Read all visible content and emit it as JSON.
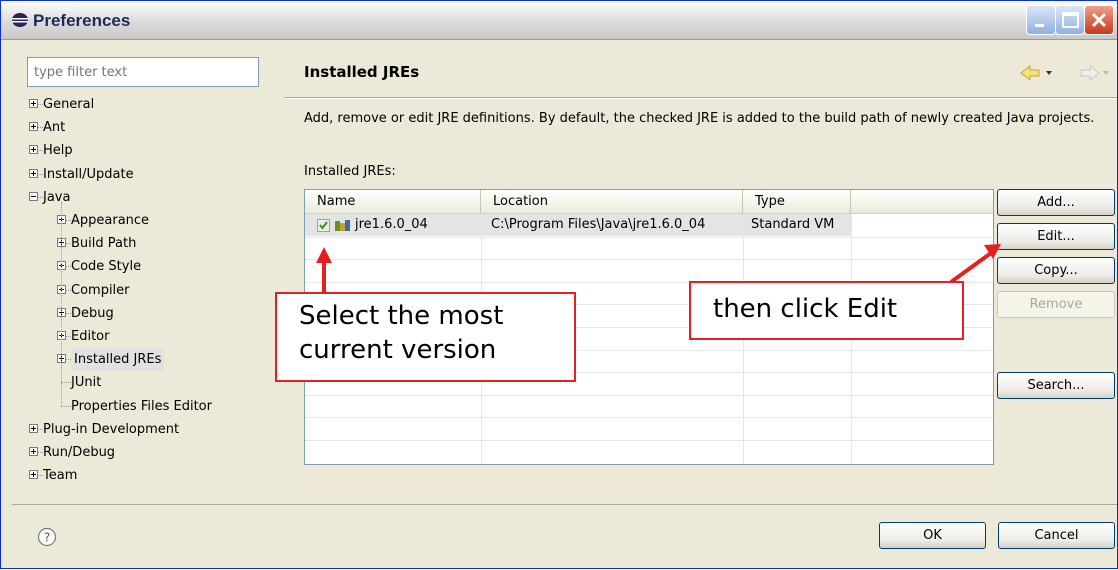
{
  "window": {
    "title": "Preferences"
  },
  "filter": {
    "placeholder": "type filter text"
  },
  "tree": [
    {
      "label": "General",
      "expander": "plus",
      "indent": 0
    },
    {
      "label": "Ant",
      "expander": "plus",
      "indent": 0
    },
    {
      "label": "Help",
      "expander": "plus",
      "indent": 0
    },
    {
      "label": "Install/Update",
      "expander": "plus",
      "indent": 0
    },
    {
      "label": "Java",
      "expander": "minus",
      "indent": 0
    },
    {
      "label": "Appearance",
      "expander": "plus",
      "indent": 1
    },
    {
      "label": "Build Path",
      "expander": "plus",
      "indent": 1
    },
    {
      "label": "Code Style",
      "expander": "plus",
      "indent": 1
    },
    {
      "label": "Compiler",
      "expander": "plus",
      "indent": 1
    },
    {
      "label": "Debug",
      "expander": "plus",
      "indent": 1
    },
    {
      "label": "Editor",
      "expander": "plus",
      "indent": 1
    },
    {
      "label": "Installed JREs",
      "expander": "plus",
      "indent": 1,
      "selected": true
    },
    {
      "label": "JUnit",
      "expander": "none",
      "indent": 1
    },
    {
      "label": "Properties Files Editor",
      "expander": "none",
      "indent": 1
    },
    {
      "label": "Plug-in Development",
      "expander": "plus",
      "indent": 0
    },
    {
      "label": "Run/Debug",
      "expander": "plus",
      "indent": 0
    },
    {
      "label": "Team",
      "expander": "plus",
      "indent": 0
    }
  ],
  "page": {
    "title": "Installed JREs",
    "description": "Add, remove or edit JRE definitions. By default, the checked JRE is added to the build path of newly created Java projects.",
    "table_label": "Installed JREs:"
  },
  "table": {
    "headers": [
      "Name",
      "Location",
      "Type"
    ],
    "rows": [
      {
        "checked": true,
        "name": "jre1.6.0_04",
        "location": "C:\\Program Files\\Java\\jre1.6.0_04",
        "type": "Standard VM"
      }
    ]
  },
  "buttons": {
    "add": "Add...",
    "edit": "Edit...",
    "copy": "Copy...",
    "remove": "Remove",
    "search": "Search...",
    "ok": "OK",
    "cancel": "Cancel"
  },
  "annotations": {
    "select": "Select the most current version",
    "edit": "then click Edit"
  },
  "colors": {
    "callout_border": "#e62020",
    "title_blue": "#1c2a55"
  }
}
